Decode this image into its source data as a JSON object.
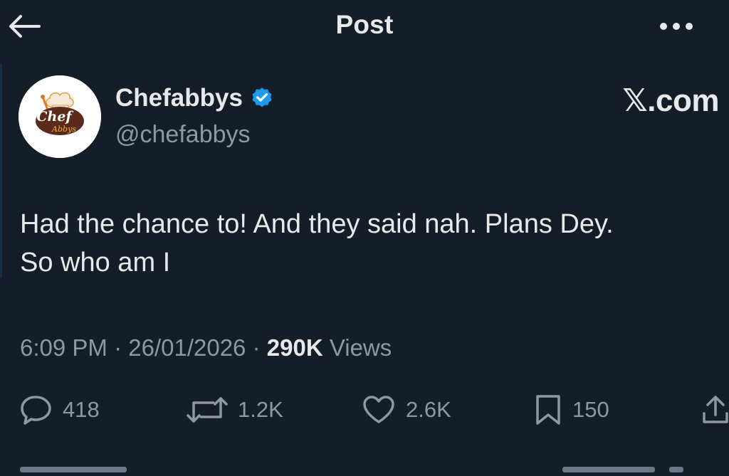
{
  "header": {
    "title": "Post",
    "back_icon": "arrow-left-icon",
    "more_icon": "more-horizontal-icon"
  },
  "author": {
    "name": "Chefabbys",
    "handle": "@chefabbys",
    "verified_icon": "verified-badge-icon",
    "verified_color": "#1d9bf0",
    "avatar_text_1": "Chef",
    "avatar_text_2": "Abbys"
  },
  "source": "𝕏.com",
  "post": {
    "lines": [
      "Had the chance to! And they said nah. Plans Dey.",
      "So who am I"
    ]
  },
  "meta": {
    "time": "6:09 PM",
    "date": "26/01/2026",
    "separator": "·",
    "views_count": "290K",
    "views_label": "Views"
  },
  "actions": {
    "replies": "418",
    "reposts": "1.2K",
    "likes": "2.6K",
    "bookmarks": "150"
  },
  "colors": {
    "background": "#151d28",
    "text": "#e7e9ea",
    "muted": "#8b98a5"
  }
}
